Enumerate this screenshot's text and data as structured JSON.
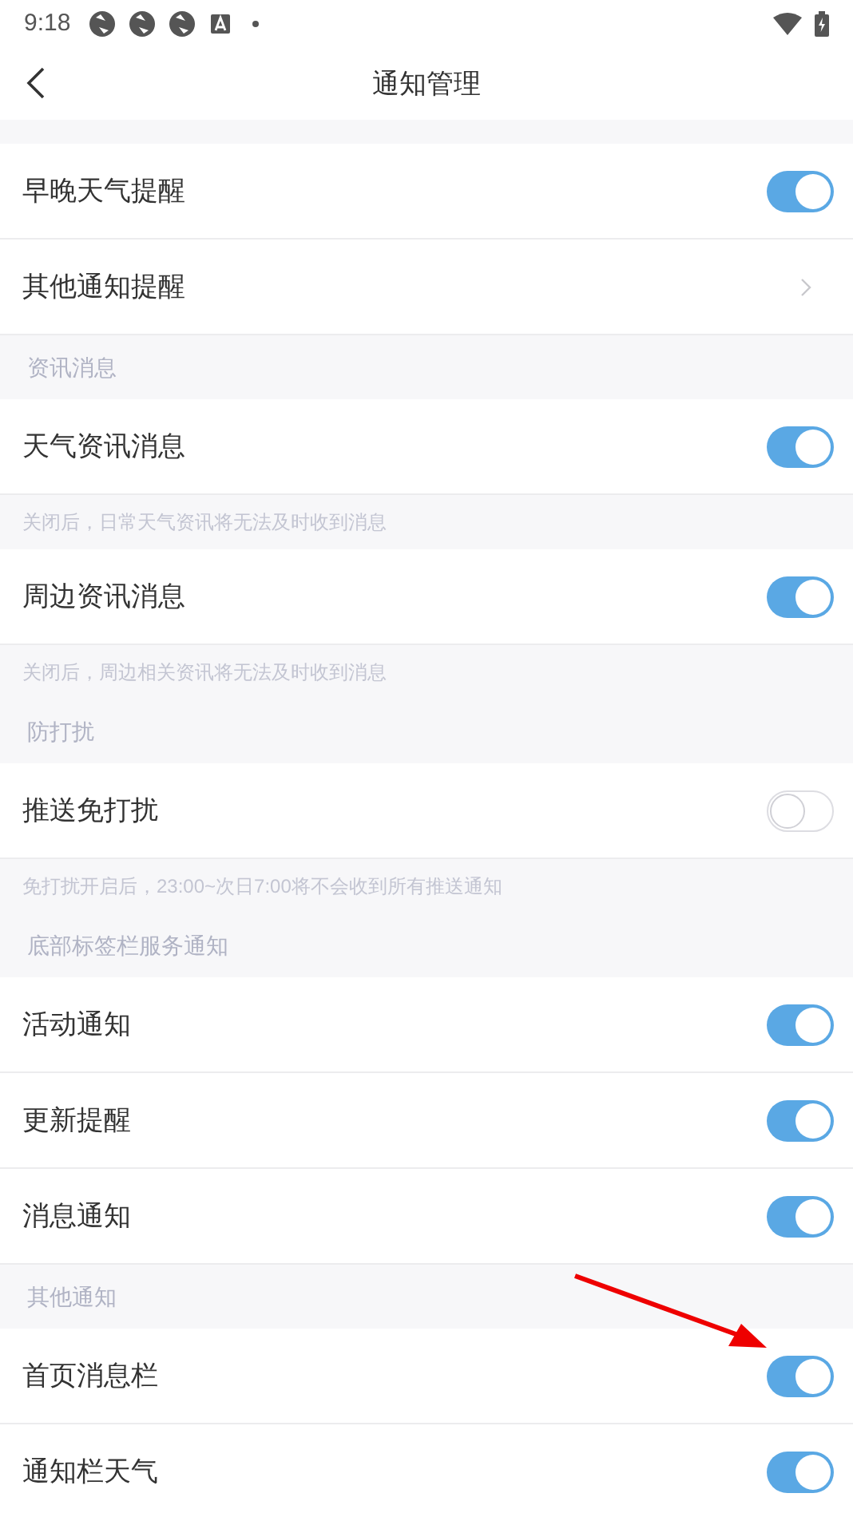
{
  "status_bar": {
    "time": "9:18"
  },
  "header": {
    "title": "通知管理"
  },
  "items": [
    {
      "kind": "toggle",
      "text": "早晚天气提醒",
      "on": true
    },
    {
      "kind": "link",
      "text": "其他通知提醒"
    },
    {
      "kind": "section",
      "text": "资讯消息",
      "clipped": false
    },
    {
      "kind": "toggle",
      "text": "天气资讯消息",
      "on": true
    },
    {
      "kind": "note",
      "text": "关闭后，日常天气资讯将无法及时收到消息"
    },
    {
      "kind": "toggle",
      "text": "周边资讯消息",
      "on": true
    },
    {
      "kind": "note",
      "text": "关闭后，周边相关资讯将无法及时收到消息"
    },
    {
      "kind": "section",
      "text": "防打扰",
      "clipped": false
    },
    {
      "kind": "toggle",
      "text": "推送免打扰",
      "on": false
    },
    {
      "kind": "note",
      "text": "免打扰开启后，23:00~次日7:00将不会收到所有推送通知"
    },
    {
      "kind": "section",
      "text": "底部标签栏服务通知",
      "clipped": false
    },
    {
      "kind": "toggle",
      "text": "活动通知",
      "on": true
    },
    {
      "kind": "toggle",
      "text": "更新提醒",
      "on": true
    },
    {
      "kind": "toggle",
      "text": "消息通知",
      "on": true
    },
    {
      "kind": "section",
      "text": "其他通知",
      "clipped": false
    },
    {
      "kind": "toggle",
      "text": "首页消息栏",
      "on": true
    },
    {
      "kind": "toggle",
      "text": "通知栏天气",
      "on": true
    }
  ]
}
